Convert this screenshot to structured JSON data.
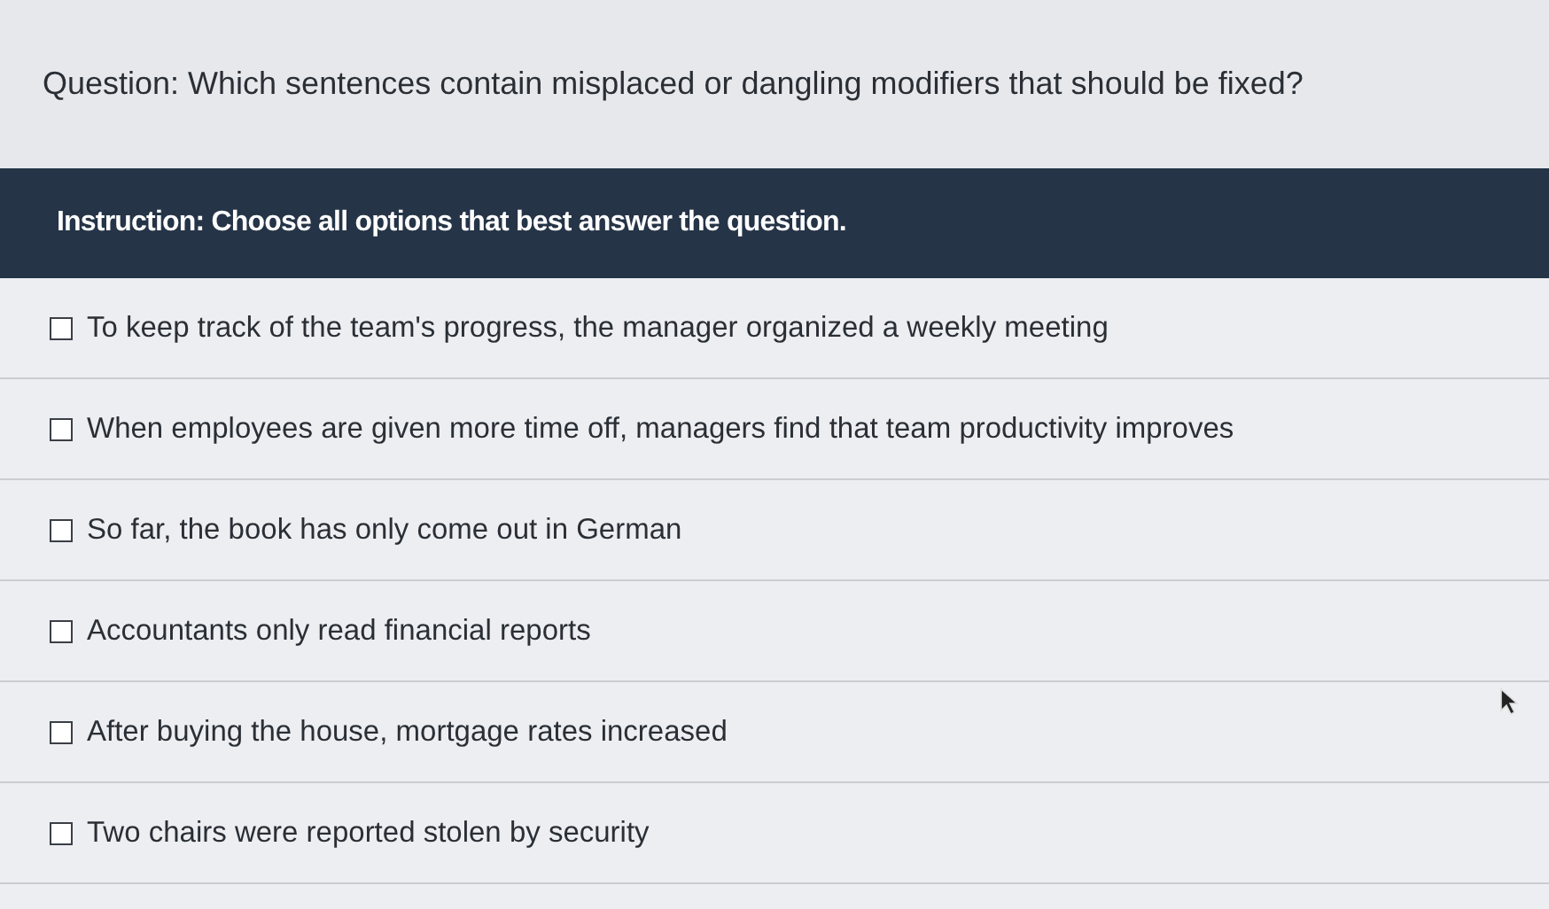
{
  "question": "Question: Which sentences contain misplaced or dangling modifiers that should be fixed?",
  "instruction": "Instruction: Choose all options that best answer the question.",
  "options": [
    {
      "label": "To keep track of the team's progress, the manager organized a weekly meeting",
      "checked": false
    },
    {
      "label": "When employees are given more time off, managers find that team productivity improves",
      "checked": false
    },
    {
      "label": "So far, the book has only come out in German",
      "checked": false
    },
    {
      "label": "Accountants only read financial reports",
      "checked": false
    },
    {
      "label": "After buying the house, mortgage rates increased",
      "checked": false
    },
    {
      "label": "Two chairs were reported stolen by security",
      "checked": false
    }
  ]
}
